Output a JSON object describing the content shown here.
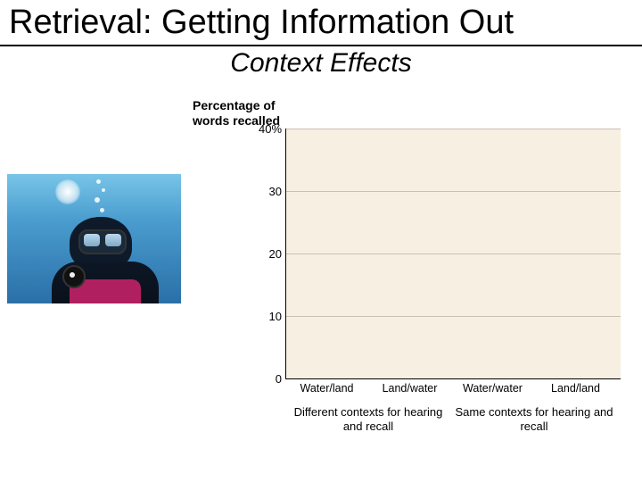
{
  "title": "Retrieval: Getting Information Out",
  "subtitle": "Context Effects",
  "photo_alt": "scuba-diver-underwater",
  "chart_data": {
    "type": "bar",
    "title": "",
    "ylabel": "Percentage of words recalled",
    "xlabel": "",
    "ylim": [
      0,
      40
    ],
    "yticks": [
      0,
      10,
      20,
      30,
      40
    ],
    "ytick_labels": [
      "0",
      "10",
      "20",
      "30",
      "40%"
    ],
    "categories": [
      "Water/land",
      "Land/water",
      "Water/water",
      "Land/land"
    ],
    "values": [
      null,
      null,
      null,
      null
    ],
    "groups": [
      {
        "label": "Different contexts for hearing and recall",
        "span": [
          0,
          1
        ]
      },
      {
        "label": "Same contexts for hearing and recall",
        "span": [
          2,
          3
        ]
      }
    ]
  }
}
